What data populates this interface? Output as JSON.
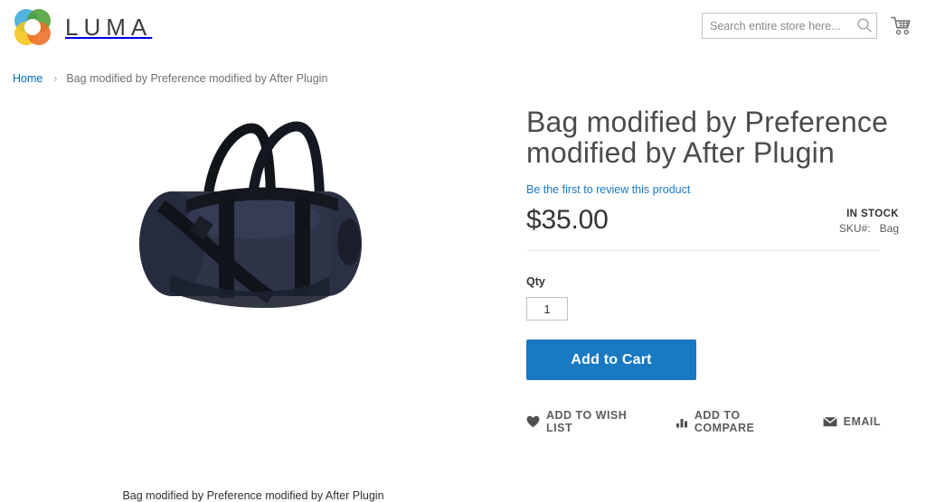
{
  "header": {
    "logo_text": "LUMA",
    "logo_icon": "luma-flower-logo",
    "search": {
      "placeholder": "Search entire store here...",
      "value": "",
      "icon": "search-icon"
    },
    "cart_icon": "shopping-cart-icon"
  },
  "breadcrumb": {
    "home_label": "Home",
    "separator": "›",
    "current_label": "Bag modified by Preference modified by After Plugin"
  },
  "gallery": {
    "hint_text": "",
    "image_alt": "navy-duffel-bag",
    "caption": "Bag modified by Preference modified by After Plugin"
  },
  "product": {
    "title": "Bag modified by Preference modified by After Plugin",
    "review_link_label": "Be the first to review this product",
    "price": "$35.00",
    "stock_status": "IN STOCK",
    "sku_label": "SKU#:",
    "sku_value": "Bag",
    "qty_label": "Qty",
    "qty_value": "1",
    "add_to_cart_label": "Add to Cart"
  },
  "actions": [
    {
      "label": "ADD TO WISH LIST",
      "icon": "heart-icon"
    },
    {
      "label": "ADD TO COMPARE",
      "icon": "bar-chart-icon"
    },
    {
      "label": "EMAIL",
      "icon": "envelope-icon"
    }
  ],
  "colors": {
    "accent_blue": "#1979c3",
    "link_blue": "#006bb4",
    "text_dark": "#333333",
    "text_muted": "#6e716e",
    "border_gray": "#c2c2c2"
  }
}
